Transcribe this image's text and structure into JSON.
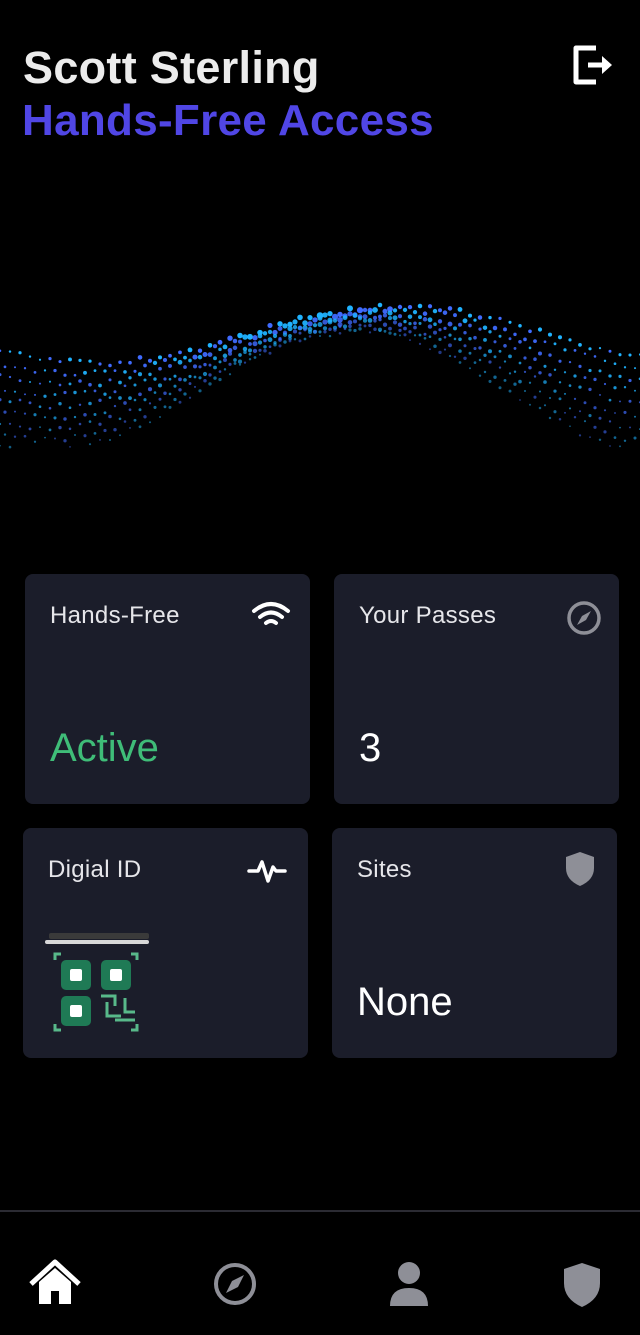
{
  "header": {
    "user_name": "Scott Sterling",
    "subtitle": "Hands-Free Access"
  },
  "colors": {
    "background": "#000000",
    "card": "#1b1d2a",
    "accent": "#5046e5",
    "active": "#3fbd78",
    "wave_cyan": "#1fb2ff",
    "wave_blue": "#3f6bff"
  },
  "cards": [
    {
      "title": "Hands-Free",
      "value": "Active",
      "icon": "wifi-icon"
    },
    {
      "title": "Your Passes",
      "value": "3",
      "icon": "compass-icon"
    },
    {
      "title": "Digial ID",
      "value": "",
      "icon": "pulse-icon",
      "graphic": "qr-code-scan-icon"
    },
    {
      "title": "Sites",
      "value": "None",
      "icon": "shield-icon"
    }
  ],
  "nav": [
    {
      "icon": "home-icon",
      "active": true
    },
    {
      "icon": "compass-icon",
      "active": false
    },
    {
      "icon": "user-icon",
      "active": false
    },
    {
      "icon": "shield-icon",
      "active": false
    }
  ]
}
